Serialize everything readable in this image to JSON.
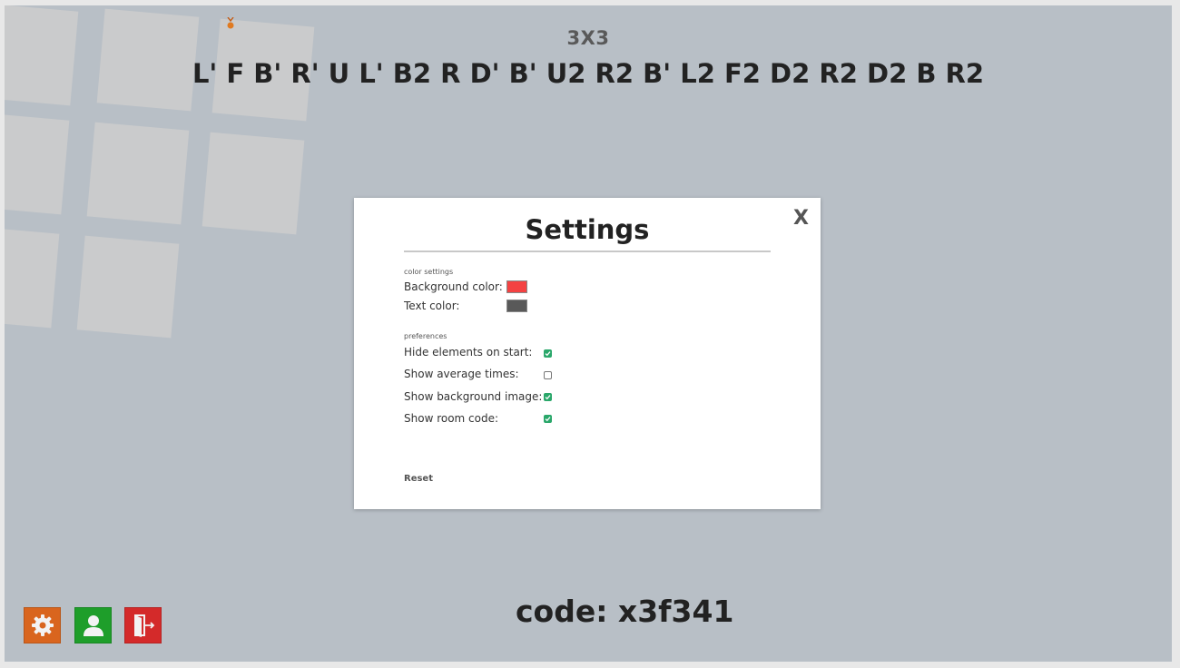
{
  "header": {
    "puzzle_type": "3X3",
    "scramble": "L' F B' R' U L' B2 R D' B' U2 R2 B' L2 F2 D2 R2 D2 B R2"
  },
  "footer": {
    "room_code": "code: x3f341"
  },
  "toolbar": {
    "settings_icon": "gear-icon",
    "profile_icon": "user-icon",
    "exit_icon": "exit-door-icon",
    "colors": {
      "settings": "#d9651e",
      "profile": "#1e9e2a",
      "exit": "#d42a2a"
    }
  },
  "settings_modal": {
    "close_label": "X",
    "title": "Settings",
    "color_section_label": "color settings",
    "background_color_label": "Background color:",
    "background_color_value": "#f44242",
    "text_color_label": "Text color:",
    "text_color_value": "#595959",
    "preferences_section_label": "preferences",
    "preferences": [
      {
        "label": "Hide elements on start:",
        "checked": true
      },
      {
        "label": "Show average times:",
        "checked": false
      },
      {
        "label": "Show background image:",
        "checked": true
      },
      {
        "label": "Show room code:",
        "checked": true
      }
    ],
    "reset_label": "Reset"
  }
}
